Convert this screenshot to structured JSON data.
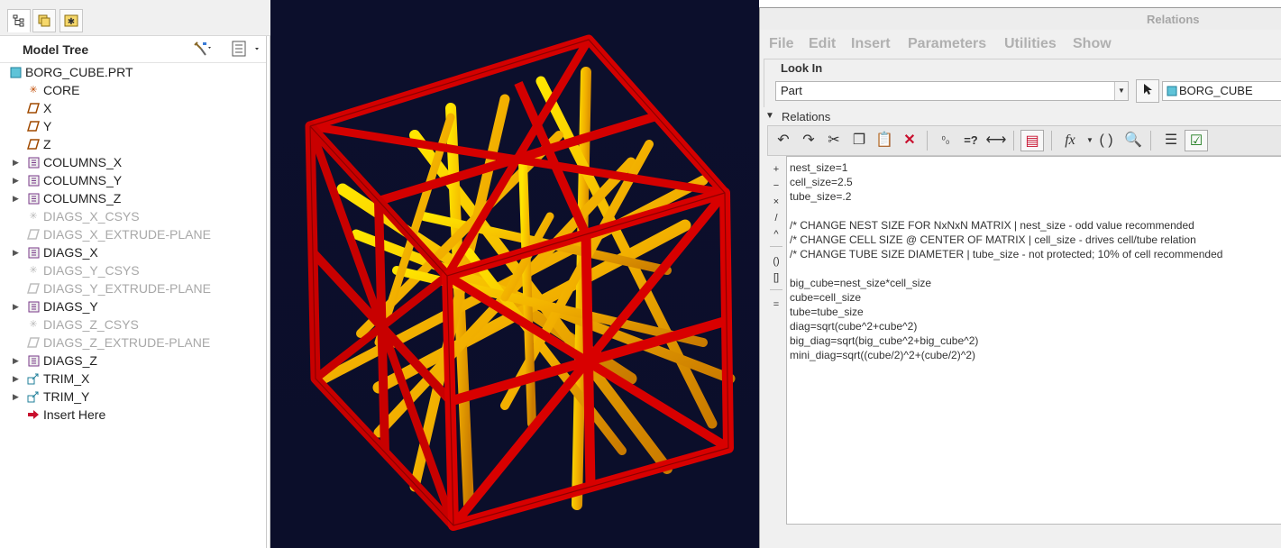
{
  "tree": {
    "title": "Model Tree",
    "items": [
      {
        "label": "BORG_CUBE.PRT",
        "level": 0,
        "expander": false,
        "icon": "part-icon",
        "dim": false
      },
      {
        "label": "CORE",
        "level": 1,
        "expander": false,
        "icon": "csys-icon",
        "dim": false
      },
      {
        "label": "X",
        "level": 1,
        "expander": false,
        "icon": "datum-plane-icon",
        "dim": false
      },
      {
        "label": "Y",
        "level": 1,
        "expander": false,
        "icon": "datum-plane-icon",
        "dim": false
      },
      {
        "label": "Z",
        "level": 1,
        "expander": false,
        "icon": "datum-plane-icon",
        "dim": false
      },
      {
        "label": "COLUMNS_X",
        "level": 1,
        "expander": true,
        "icon": "group-icon",
        "dim": false
      },
      {
        "label": "COLUMNS_Y",
        "level": 1,
        "expander": true,
        "icon": "group-icon",
        "dim": false
      },
      {
        "label": "COLUMNS_Z",
        "level": 1,
        "expander": true,
        "icon": "group-icon",
        "dim": false
      },
      {
        "label": "DIAGS_X_CSYS",
        "level": 1,
        "expander": false,
        "icon": "csys-icon",
        "dim": true
      },
      {
        "label": "DIAGS_X_EXTRUDE-PLANE",
        "level": 1,
        "expander": false,
        "icon": "datum-plane-icon",
        "dim": true
      },
      {
        "label": "DIAGS_X",
        "level": 1,
        "expander": true,
        "icon": "group-icon",
        "dim": false
      },
      {
        "label": "DIAGS_Y_CSYS",
        "level": 1,
        "expander": false,
        "icon": "csys-icon",
        "dim": true
      },
      {
        "label": "DIAGS_Y_EXTRUDE-PLANE",
        "level": 1,
        "expander": false,
        "icon": "datum-plane-icon",
        "dim": true
      },
      {
        "label": "DIAGS_Y",
        "level": 1,
        "expander": true,
        "icon": "group-icon",
        "dim": false
      },
      {
        "label": "DIAGS_Z_CSYS",
        "level": 1,
        "expander": false,
        "icon": "csys-icon",
        "dim": true
      },
      {
        "label": "DIAGS_Z_EXTRUDE-PLANE",
        "level": 1,
        "expander": false,
        "icon": "datum-plane-icon",
        "dim": true
      },
      {
        "label": "DIAGS_Z",
        "level": 1,
        "expander": true,
        "icon": "group-icon",
        "dim": false
      },
      {
        "label": "TRIM_X",
        "level": 1,
        "expander": true,
        "icon": "trim-icon",
        "dim": false
      },
      {
        "label": "TRIM_Y",
        "level": 1,
        "expander": true,
        "icon": "trim-icon",
        "dim": false
      },
      {
        "label": "Insert Here",
        "level": 1,
        "expander": false,
        "icon": "insert-arrow-icon",
        "dim": false
      }
    ]
  },
  "colors": {
    "viewport_bg": "#0b0e2a",
    "frame_red": "#d30000",
    "tube_orange": "#f2a400",
    "tube_yellow": "#f5dc00"
  },
  "dialog": {
    "title": "Relations",
    "menu": [
      "File",
      "Edit",
      "Insert",
      "Parameters",
      "Utilities",
      "Show"
    ],
    "look_in_label": "Look In",
    "look_in_value": "Part",
    "object_value": "BORG_CUBE",
    "relations_label": "Relations",
    "code_lines": [
      "nest_size=1",
      "cell_size=2.5",
      "tube_size=.2",
      "",
      "/* CHANGE NEST SIZE FOR NxNxN MATRIX | nest_size - odd value recommended",
      "/* CHANGE CELL SIZE @ CENTER OF MATRIX | cell_size - drives cell/tube relation",
      "/* CHANGE TUBE SIZE DIAMETER | tube_size - not protected; 10% of cell recommended",
      "",
      "big_cube=nest_size*cell_size",
      "cube=cell_size",
      "tube=tube_size",
      "diag=sqrt(cube^2+cube^2)",
      "big_diag=sqrt(big_cube^2+big_cube^2)",
      "mini_diag=sqrt((cube/2)^2+(cube/2)^2)"
    ]
  }
}
